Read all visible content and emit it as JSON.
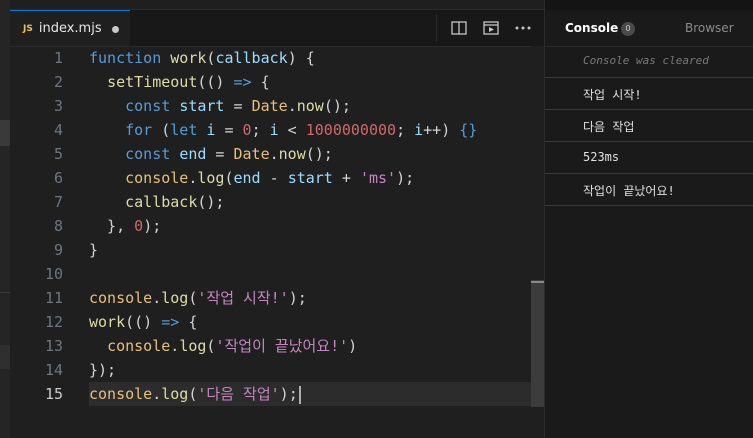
{
  "editor": {
    "tab": {
      "badge": "JS",
      "title": "index.mjs"
    },
    "active_line": 15,
    "lines": [
      {
        "n": "1",
        "tokens": [
          [
            "kw",
            "function "
          ],
          [
            "fn",
            "work"
          ],
          [
            "pl",
            "("
          ],
          [
            "prm",
            "callback"
          ],
          [
            "pl",
            ") {"
          ]
        ]
      },
      {
        "n": "2",
        "tokens": [
          [
            "pl",
            "  "
          ],
          [
            "fn",
            "setTimeout"
          ],
          [
            "pl",
            "(() "
          ],
          [
            "kw",
            "=>"
          ],
          [
            "pl",
            " {"
          ]
        ]
      },
      {
        "n": "3",
        "tokens": [
          [
            "pl",
            "    "
          ],
          [
            "kw",
            "const "
          ],
          [
            "prm",
            "start"
          ],
          [
            "pl",
            " = "
          ],
          [
            "obj",
            "Date"
          ],
          [
            "pl",
            "."
          ],
          [
            "fn",
            "now"
          ],
          [
            "pl",
            "();"
          ]
        ]
      },
      {
        "n": "4",
        "tokens": [
          [
            "pl",
            "    "
          ],
          [
            "kw",
            "for "
          ],
          [
            "pl",
            "("
          ],
          [
            "kw",
            "let "
          ],
          [
            "prm",
            "i"
          ],
          [
            "pl",
            " = "
          ],
          [
            "num",
            "0"
          ],
          [
            "pl",
            "; "
          ],
          [
            "prm",
            "i"
          ],
          [
            "pl",
            " < "
          ],
          [
            "num",
            "1000000000"
          ],
          [
            "pl",
            "; "
          ],
          [
            "prm",
            "i"
          ],
          [
            "pl",
            "++) "
          ],
          [
            "kw",
            "{}"
          ]
        ]
      },
      {
        "n": "5",
        "tokens": [
          [
            "pl",
            "    "
          ],
          [
            "kw",
            "const "
          ],
          [
            "prm",
            "end"
          ],
          [
            "pl",
            " = "
          ],
          [
            "obj",
            "Date"
          ],
          [
            "pl",
            "."
          ],
          [
            "fn",
            "now"
          ],
          [
            "pl",
            "();"
          ]
        ]
      },
      {
        "n": "6",
        "tokens": [
          [
            "pl",
            "    "
          ],
          [
            "obj",
            "console"
          ],
          [
            "pl",
            "."
          ],
          [
            "fn",
            "log"
          ],
          [
            "pl",
            "("
          ],
          [
            "prm",
            "end"
          ],
          [
            "pl",
            " - "
          ],
          [
            "prm",
            "start"
          ],
          [
            "pl",
            " + "
          ],
          [
            "str2",
            "'ms'"
          ],
          [
            "pl",
            ");"
          ]
        ]
      },
      {
        "n": "7",
        "tokens": [
          [
            "pl",
            "    "
          ],
          [
            "fn",
            "callback"
          ],
          [
            "pl",
            "();"
          ]
        ]
      },
      {
        "n": "8",
        "tokens": [
          [
            "pl",
            "  }, "
          ],
          [
            "num",
            "0"
          ],
          [
            "pl",
            ");"
          ]
        ]
      },
      {
        "n": "9",
        "tokens": [
          [
            "pl",
            "}"
          ]
        ]
      },
      {
        "n": "10",
        "tokens": []
      },
      {
        "n": "11",
        "tokens": [
          [
            "obj",
            "console"
          ],
          [
            "pl",
            "."
          ],
          [
            "fn",
            "log"
          ],
          [
            "pl",
            "("
          ],
          [
            "str2",
            "'작업 시작!'"
          ],
          [
            "pl",
            ");"
          ]
        ]
      },
      {
        "n": "12",
        "tokens": [
          [
            "fn",
            "work"
          ],
          [
            "pl",
            "(() "
          ],
          [
            "kw",
            "=>"
          ],
          [
            "pl",
            " {"
          ]
        ]
      },
      {
        "n": "13",
        "tokens": [
          [
            "pl",
            "  "
          ],
          [
            "obj",
            "console"
          ],
          [
            "pl",
            "."
          ],
          [
            "fn",
            "log"
          ],
          [
            "pl",
            "("
          ],
          [
            "str2",
            "'작업이 끝났어요!'"
          ],
          [
            "pl",
            ")"
          ]
        ]
      },
      {
        "n": "14",
        "tokens": [
          [
            "pl",
            "});"
          ]
        ]
      },
      {
        "n": "15",
        "tokens": [
          [
            "obj",
            "console"
          ],
          [
            "pl",
            "."
          ],
          [
            "fn",
            "log"
          ],
          [
            "pl",
            "("
          ],
          [
            "str2",
            "'다음 작업'"
          ],
          [
            "pl",
            ");"
          ]
        ]
      }
    ]
  },
  "panel": {
    "tabs": {
      "console": "Console",
      "console_count": "0",
      "browser": "Browser"
    },
    "rows": [
      {
        "text": "Console was cleared",
        "kind": "cleared"
      },
      {
        "text": "작업 시작!",
        "kind": "log"
      },
      {
        "text": "다음 작업",
        "kind": "log"
      },
      {
        "text": "523ms",
        "kind": "log"
      },
      {
        "text": "작업이 끝났어요!",
        "kind": "log"
      }
    ]
  },
  "colors": {
    "keyword": "#569cd6",
    "function": "#dcdcaa",
    "object": "#e5c07b",
    "param": "#9cdcfe",
    "string": "#c586c0",
    "number": "#d16969",
    "accent": "#0078d4"
  },
  "icons": [
    "split-editor-icon",
    "preview-icon",
    "more-actions-icon"
  ]
}
